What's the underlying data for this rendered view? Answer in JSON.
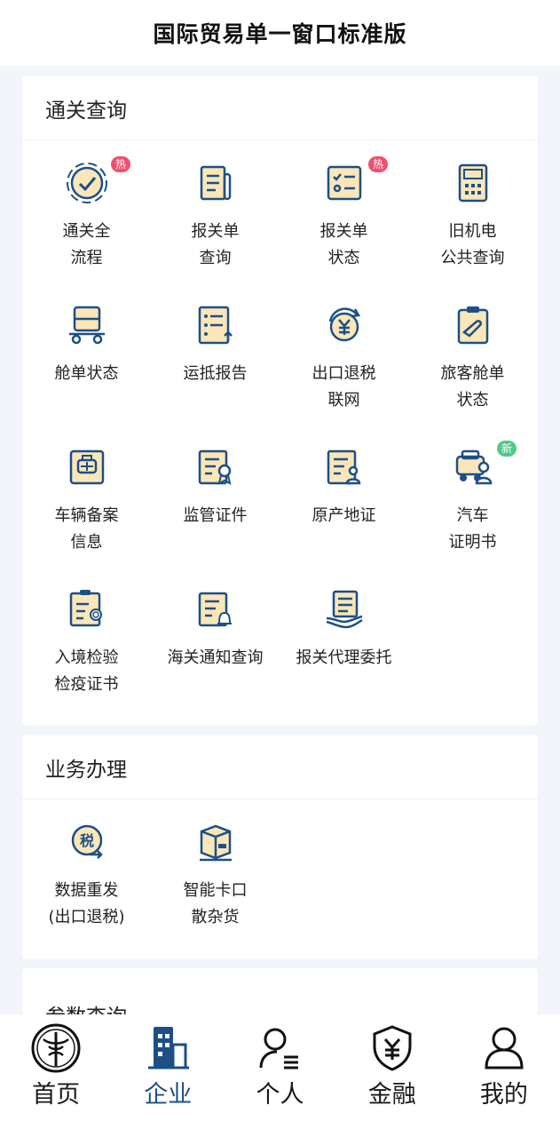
{
  "header": {
    "title": "国际贸易单一窗口标准版"
  },
  "sections": [
    {
      "title": "通关查询",
      "items": [
        {
          "label": "通关全\n流程",
          "icon": "globe-check-icon",
          "badge": "热"
        },
        {
          "label": "报关单\n查询",
          "icon": "document-icon"
        },
        {
          "label": "报关单\n状态",
          "icon": "checklist-icon",
          "badge": "热"
        },
        {
          "label": "旧机电\n公共查询",
          "icon": "calculator-icon"
        },
        {
          "label": "舱单状态",
          "icon": "cart-icon"
        },
        {
          "label": "运抵报告",
          "icon": "list-arrow-icon"
        },
        {
          "label": "出口退税\n联网",
          "icon": "yuan-refresh-icon"
        },
        {
          "label": "旅客舱单\n状态",
          "icon": "clipboard-plane-icon"
        },
        {
          "label": "车辆备案\n信息",
          "icon": "vehicle-badge-icon"
        },
        {
          "label": "监管证件",
          "icon": "certificate-icon"
        },
        {
          "label": "原产地证",
          "icon": "certificate-person-icon"
        },
        {
          "label": "汽车\n证明书",
          "icon": "car-person-icon",
          "badge": "新"
        },
        {
          "label": "入境检验\n检疫证书",
          "icon": "inspection-cert-icon"
        },
        {
          "label": "海关通知查询",
          "icon": "notice-bell-icon"
        },
        {
          "label": "报关代理委托",
          "icon": "hand-document-icon"
        }
      ]
    },
    {
      "title": "业务办理",
      "items": [
        {
          "label": "数据重发\n(出口退税)",
          "icon": "tax-resend-icon"
        },
        {
          "label": "智能卡口\n散杂货",
          "icon": "cargo-box-icon"
        }
      ]
    },
    {
      "title": "参数查询"
    }
  ],
  "tabbar": {
    "items": [
      {
        "label": "首页",
        "icon": "customs-emblem-icon"
      },
      {
        "label": "企业",
        "icon": "building-icon",
        "active": true
      },
      {
        "label": "个人",
        "icon": "person-list-icon"
      },
      {
        "label": "金融",
        "icon": "shield-yuan-icon"
      },
      {
        "label": "我的",
        "icon": "user-icon"
      }
    ]
  },
  "colors": {
    "primary": "#1d4f86",
    "icon_fill": "#fbe6b8",
    "hot": "#f0506e",
    "new": "#52c98a"
  }
}
